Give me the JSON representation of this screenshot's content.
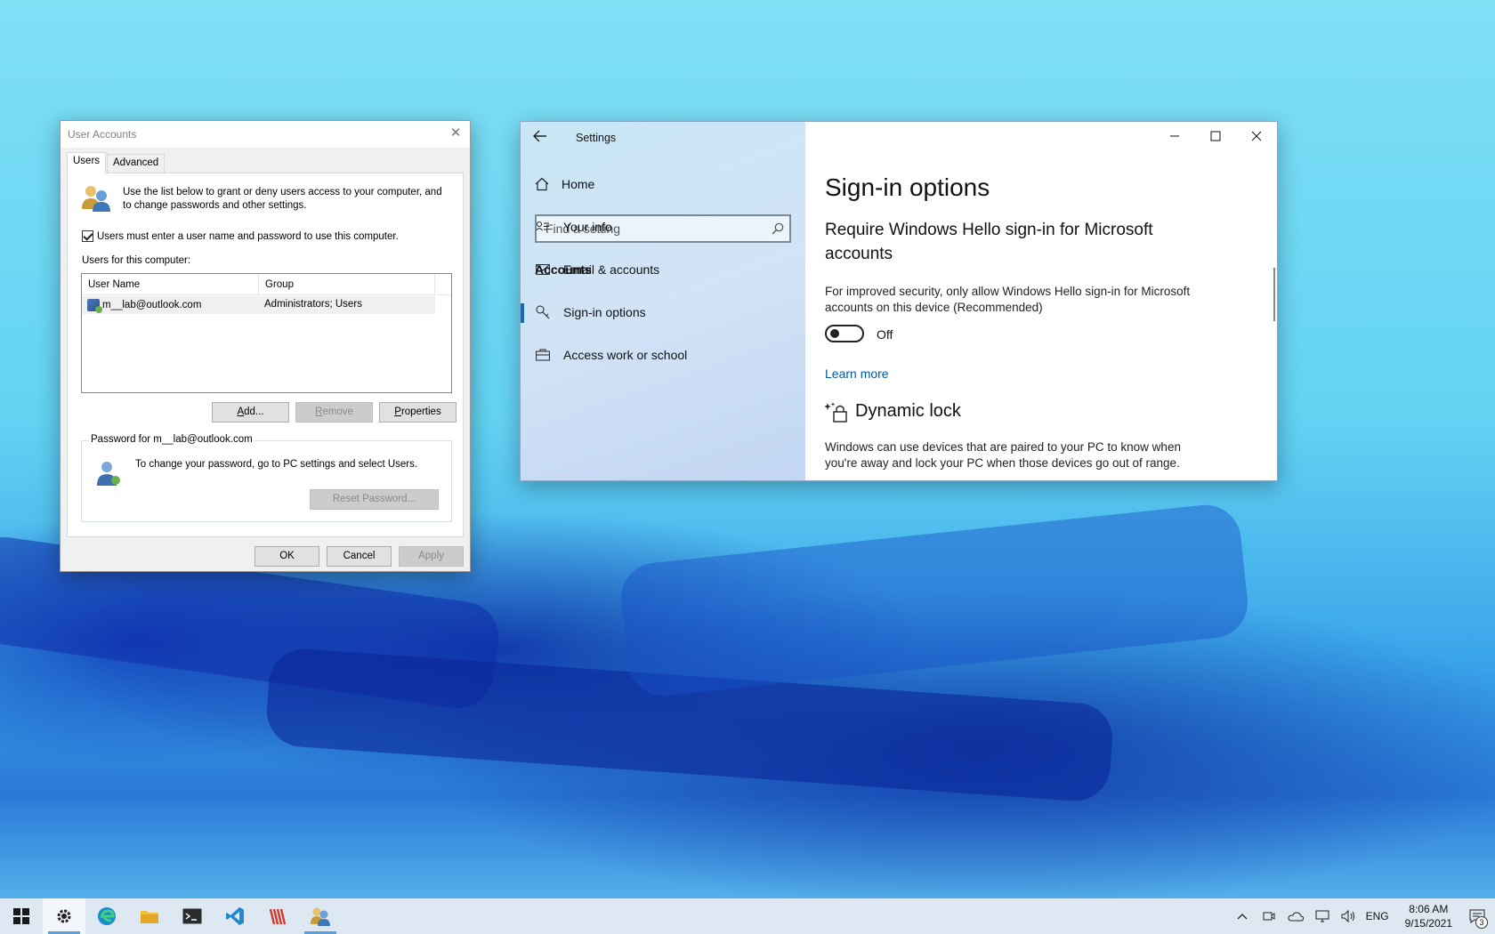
{
  "user_accounts": {
    "title": "User Accounts",
    "tabs": [
      {
        "label": "Users",
        "active": true
      },
      {
        "label": "Advanced",
        "active": false
      }
    ],
    "description": "Use the list below to grant or deny users access to your computer, and to change passwords and other settings.",
    "require_login_checkbox": {
      "label": "Users must enter a user name and password to use this computer.",
      "checked": true
    },
    "users_label": "Users for this computer:",
    "columns": [
      "User Name",
      "Group"
    ],
    "rows": [
      {
        "user": "m__lab@outlook.com",
        "group": "Administrators; Users"
      }
    ],
    "buttons": {
      "add": "Add...",
      "remove": "Remove",
      "properties": "Properties"
    },
    "password_group": {
      "label": "Password for m__lab@outlook.com",
      "text": "To change your password, go to PC settings and select Users.",
      "reset_button": "Reset Password..."
    },
    "footer": {
      "ok": "OK",
      "cancel": "Cancel",
      "apply": "Apply"
    }
  },
  "settings": {
    "app_title": "Settings",
    "home": "Home",
    "search_placeholder": "Find a setting",
    "section": "Accounts",
    "nav_items": [
      {
        "label": "Your info",
        "icon": "person-card-icon",
        "selected": false
      },
      {
        "label": "Email & accounts",
        "icon": "mail-icon",
        "selected": false
      },
      {
        "label": "Sign-in options",
        "icon": "key-icon",
        "selected": true
      },
      {
        "label": "Access work or school",
        "icon": "briefcase-icon",
        "selected": false
      }
    ],
    "page_title": "Sign-in options",
    "hello_heading": "Require Windows Hello sign-in for Microsoft accounts",
    "hello_body": "For improved security, only allow Windows Hello sign-in for Microsoft accounts on this device (Recommended)",
    "toggle_state": "Off",
    "learn_more": "Learn more",
    "dynamic_lock_heading": "Dynamic lock",
    "dynamic_lock_body": "Windows can use devices that are paired to your PC to know when you're away and lock your PC when those devices go out of range."
  },
  "taskbar": {
    "language": "ENG",
    "time": "8:06 AM",
    "date": "9/15/2021",
    "notification_count": "3",
    "accent": "#5f9ed6"
  }
}
